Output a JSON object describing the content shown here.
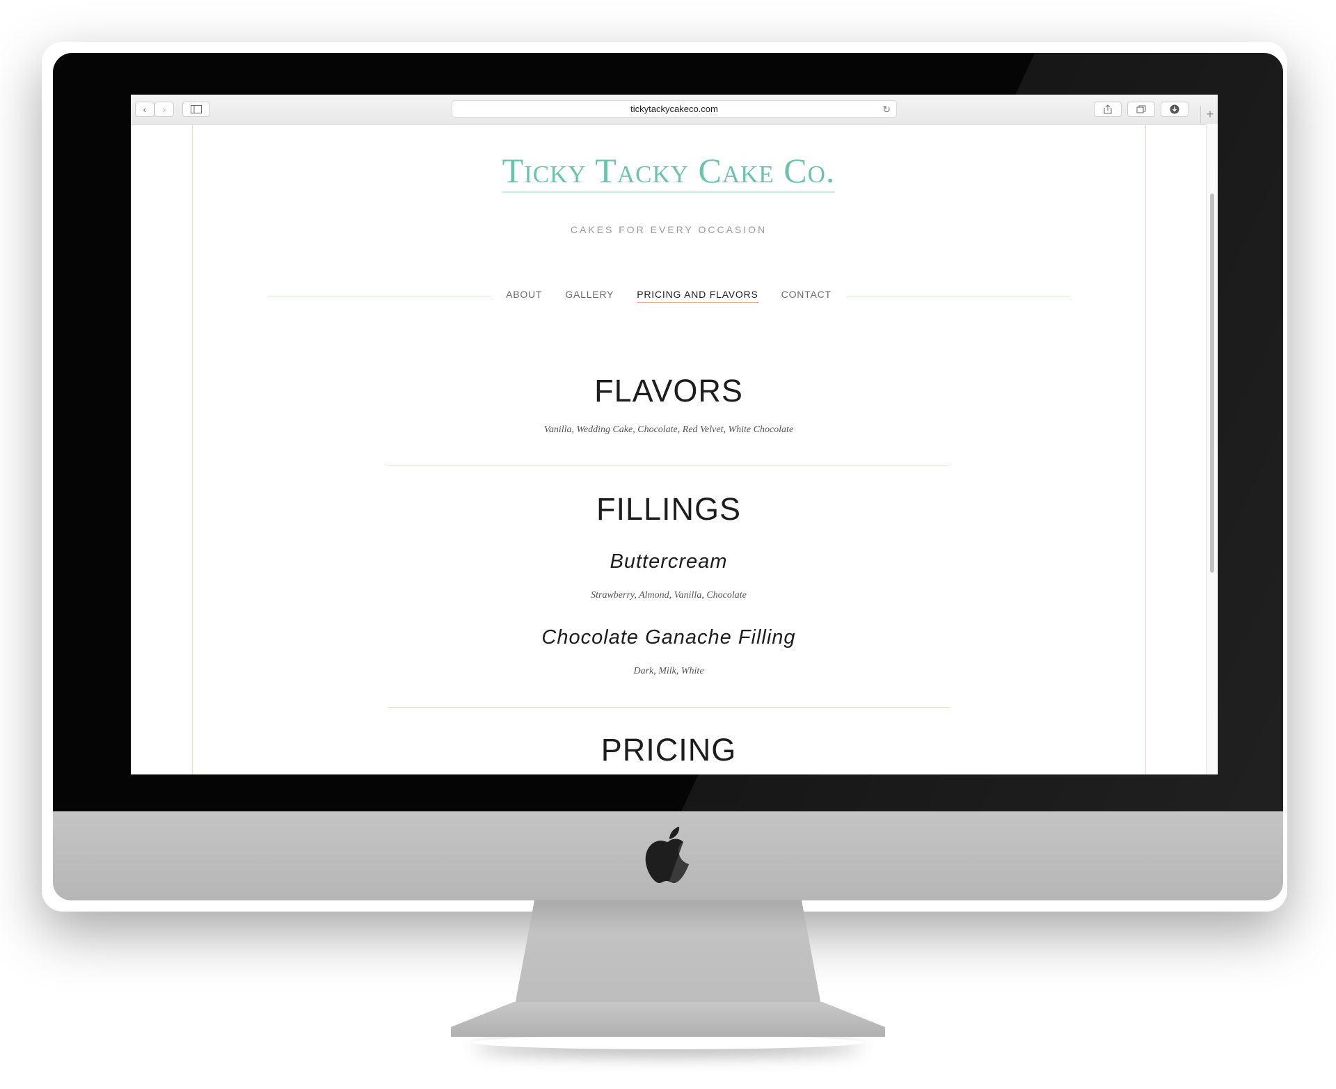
{
  "browser": {
    "url": "tickytackycakeco.com",
    "new_tab_label": "+"
  },
  "site": {
    "title": "Ticky Tacky Cake Co.",
    "tagline": "CAKES FOR EVERY OCCASION"
  },
  "nav": {
    "items": [
      {
        "label": "ABOUT"
      },
      {
        "label": "GALLERY"
      },
      {
        "label": "PRICING AND FLAVORS"
      },
      {
        "label": "CONTACT"
      }
    ]
  },
  "sections": {
    "flavors": {
      "heading": "FLAVORS",
      "text": "Vanilla, Wedding Cake, Chocolate, Red Velvet, White Chocolate"
    },
    "fillings": {
      "heading": "FILLINGS",
      "items": [
        {
          "name": "Buttercream",
          "options": "Strawberry, Almond, Vanilla, Chocolate"
        },
        {
          "name": "Chocolate Ganache Filling",
          "options": "Dark, Milk, White"
        }
      ]
    },
    "pricing": {
      "heading": "PRICING"
    }
  },
  "colors": {
    "title": "#6bc3ad",
    "accent_line": "#f1d8cc"
  }
}
